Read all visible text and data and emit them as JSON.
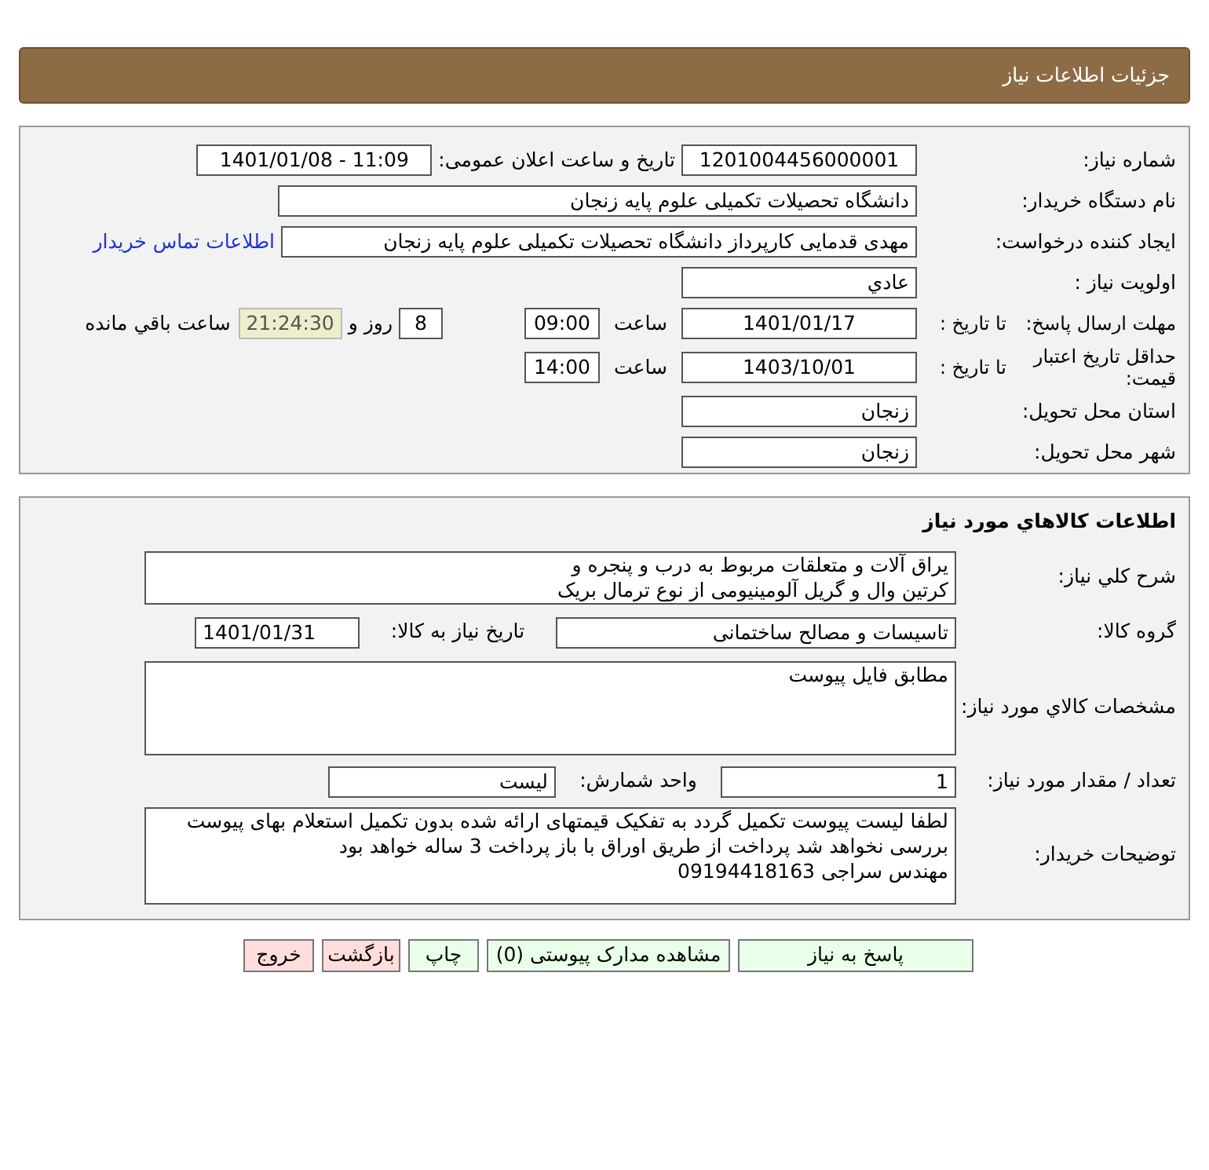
{
  "header": {
    "title": "جزئیات اطلاعات نیاز"
  },
  "details": {
    "need_number": {
      "label": "شماره نیاز:",
      "value": "1201004456000001"
    },
    "announce": {
      "label": "تاریخ و ساعت اعلان عمومی:",
      "value": "1401/01/08 - 11:09"
    },
    "buyer": {
      "label": "نام دستگاه خریدار:",
      "value": "دانشگاه تحصیلات تکمیلی علوم پایه زنجان"
    },
    "creator": {
      "label": "ایجاد کننده درخواست:",
      "value": "مهدی قدمایی کارپرداز دانشگاه تحصیلات تکمیلی علوم پایه زنجان",
      "link": "اطلاعات تماس خریدار"
    },
    "priority": {
      "label": "اولویت نیاز :",
      "value": "عادي"
    },
    "deadline": {
      "label": "مهلت ارسال پاسخ:",
      "to_label": "تا تاریخ :",
      "date": "1401/01/17",
      "time_label": "ساعت",
      "time": "09:00",
      "days": "8",
      "days_label": "روز و",
      "remaining": "21:24:30",
      "remaining_label": "ساعت باقي مانده"
    },
    "validity": {
      "label": "حداقل تاریخ اعتبار قیمت:",
      "to_label": "تا تاریخ :",
      "date": "1403/10/01",
      "time_label": "ساعت",
      "time": "14:00"
    },
    "province": {
      "label": "استان محل تحویل:",
      "value": "زنجان"
    },
    "city": {
      "label": "شهر محل تحویل:",
      "value": "زنجان"
    }
  },
  "goods": {
    "title": "اطلاعات کالاهاي مورد نياز",
    "description": {
      "label": "شرح کلي نياز:",
      "lines": [
        "یراق آلات و متعلقات مربوط به درب و پنجره و",
        "کرتین وال و گریل آلومینیومی از نوع ترمال بریک"
      ]
    },
    "group": {
      "label": "گروه کالا:",
      "value": "تاسیسات و مصالح ساختمانی",
      "date_label": "تاریخ نیاز به کالا:",
      "date": "1401/01/31"
    },
    "specs": {
      "label": "مشخصات کالاي مورد نياز:",
      "lines": [
        "مطابق فایل پیوست"
      ]
    },
    "quantity": {
      "label": "تعداد / مقدار مورد نیاز:",
      "value": "1",
      "unit_label": "واحد شمارش:",
      "unit": "لیست"
    },
    "notes": {
      "label": "توضیحات خریدار:",
      "lines": [
        "لطفا لیست پیوست تکمیل گردد به تفکیک قیمتهای ارائه شده بدون تکمیل استعلام بهای پیوست",
        "بررسی نخواهد شد پرداخت از طریق اوراق با باز پرداخت 3 ساله خواهد بود",
        "مهندس سراجی 09194418163"
      ]
    }
  },
  "buttons": [
    {
      "label": "پاسخ به نیاز",
      "kind": "normal"
    },
    {
      "label": "مشاهده مدارک پیوستی (0)",
      "kind": "normal"
    },
    {
      "label": "چاپ",
      "kind": "normal"
    },
    {
      "label": "بازگشت",
      "kind": "alert"
    },
    {
      "label": "خروج",
      "kind": "alert"
    }
  ]
}
